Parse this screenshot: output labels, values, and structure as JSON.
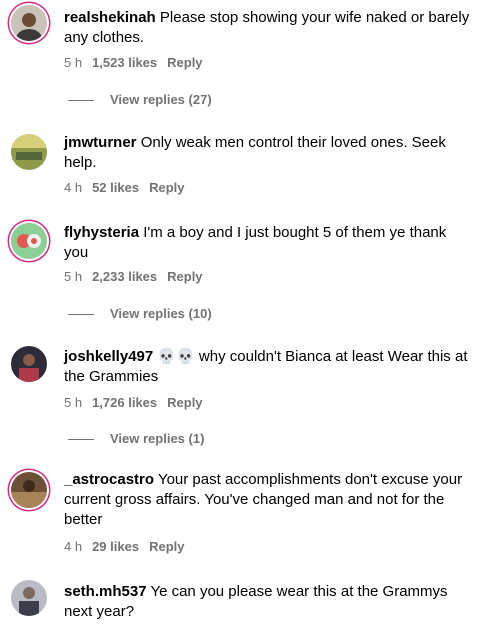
{
  "comments": [
    {
      "user": "realshekinah",
      "text": "Please stop showing your wife naked or barely any clothes.",
      "time": "5 h",
      "likes": "1,523 likes",
      "reply": "Reply",
      "view_replies": "View replies (27)"
    },
    {
      "user": "jmwturner",
      "text": "Only weak men control their loved ones. Seek help.",
      "time": "4 h",
      "likes": "52 likes",
      "reply": "Reply"
    },
    {
      "user": "flyhysteria",
      "text": "I'm a boy and I just bought 5 of them ye thank you",
      "time": "5 h",
      "likes": "2,233 likes",
      "reply": "Reply",
      "view_replies": "View replies (10)"
    },
    {
      "user": "joshkelly497",
      "text": "💀💀 why couldn't Bianca at least Wear this at the Grammies",
      "time": "5 h",
      "likes": "1,726 likes",
      "reply": "Reply",
      "view_replies": "View replies (1)"
    },
    {
      "user": "_astrocastro",
      "text": "Your past accomplishments don't excuse your current gross affairs. You've changed man and not for the better",
      "time": "4 h",
      "likes": "29 likes",
      "reply": "Reply"
    },
    {
      "user": "seth.mh537",
      "text": "Ye can you please wear this at the Grammys next year?"
    }
  ]
}
